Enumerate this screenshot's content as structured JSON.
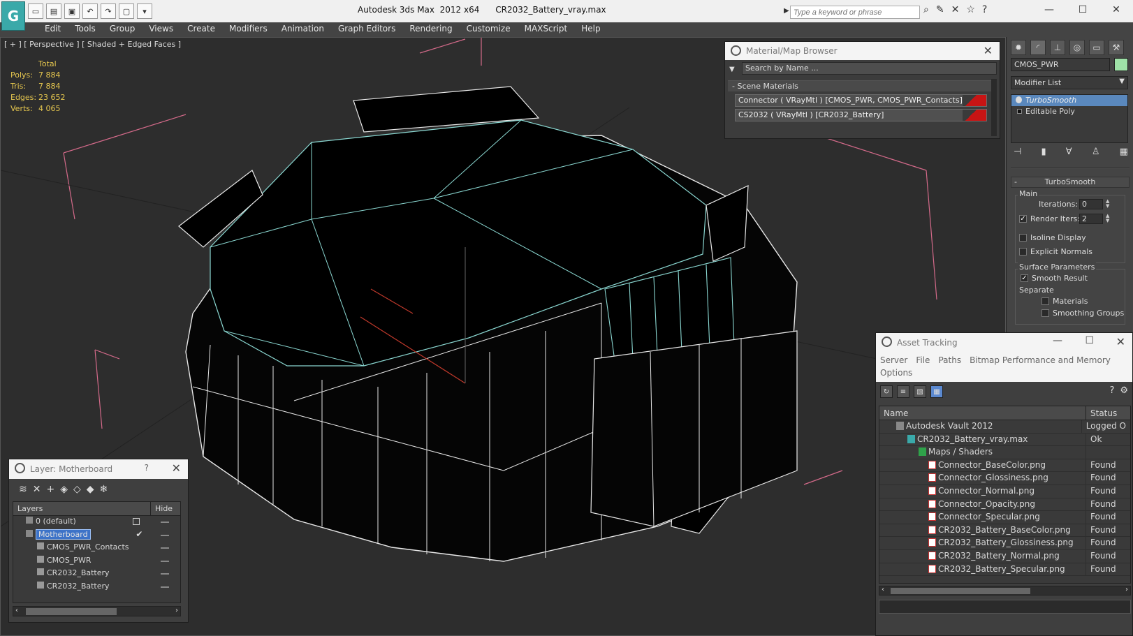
{
  "title": {
    "app": "Autodesk 3ds Max  2012 x64",
    "file": "CR2032_Battery_vray.max",
    "search_placeholder": "Type a keyword or phrase"
  },
  "menu": [
    "Edit",
    "Tools",
    "Group",
    "Views",
    "Create",
    "Modifiers",
    "Animation",
    "Graph Editors",
    "Rendering",
    "Customize",
    "MAXScript",
    "Help"
  ],
  "viewport": {
    "label": "[ + ] [ Perspective ] [ Shaded + Edged Faces ]",
    "stats": {
      "header": "Total",
      "rows": [
        {
          "k": "Polys:",
          "v": "7 884"
        },
        {
          "k": "Tris:",
          "v": "7 884"
        },
        {
          "k": "Edges:",
          "v": "23 652"
        },
        {
          "k": "Verts:",
          "v": "4 065"
        }
      ]
    }
  },
  "material_browser": {
    "title": "Material/Map Browser",
    "search": "Search by Name ...",
    "group": "- Scene Materials",
    "materials": [
      "Connector  ( VRayMtl ) [CMOS_PWR, CMOS_PWR_Contacts]",
      "CS2032  ( VRayMtl ) [CR2032_Battery]"
    ],
    "swatch_color": "#c81414"
  },
  "command_panel": {
    "object_name": "CMOS_PWR",
    "object_color": "#9fe2a8",
    "modifier_list": "Modifier List",
    "stack": [
      "TurboSmooth",
      "Editable Poly"
    ],
    "rollout": "TurboSmooth",
    "main_label": "Main",
    "iterations_label": "Iterations:",
    "iterations_value": "0",
    "render_iters_label": "Render Iters:",
    "render_iters_value": "2",
    "isoline": "Isoline Display",
    "explicit": "Explicit Normals",
    "surface_label": "Surface Parameters",
    "smooth_result": "Smooth Result",
    "separate": "Separate",
    "materials": "Materials",
    "smoothing_groups": "Smoothing Groups"
  },
  "asset_tracking": {
    "title": "Asset Tracking",
    "menu": [
      "Server",
      "File",
      "Paths",
      "Bitmap Performance and Memory",
      "Options"
    ],
    "columns": [
      "Name",
      "Status"
    ],
    "rows": [
      {
        "name": "Autodesk Vault 2012",
        "status": "Logged O",
        "indent": 1,
        "icon": "vault-icon"
      },
      {
        "name": "CR2032_Battery_vray.max",
        "status": "Ok",
        "indent": 2,
        "icon": "max-file-icon"
      },
      {
        "name": "Maps / Shaders",
        "status": "",
        "indent": 3,
        "icon": "maps-folder-icon"
      },
      {
        "name": "Connector_BaseColor.png",
        "status": "Found",
        "indent": 4,
        "icon": "png-icon"
      },
      {
        "name": "Connector_Glossiness.png",
        "status": "Found",
        "indent": 4,
        "icon": "png-icon"
      },
      {
        "name": "Connector_Normal.png",
        "status": "Found",
        "indent": 4,
        "icon": "png-icon"
      },
      {
        "name": "Connector_Opacity.png",
        "status": "Found",
        "indent": 4,
        "icon": "png-icon"
      },
      {
        "name": "Connector_Specular.png",
        "status": "Found",
        "indent": 4,
        "icon": "png-icon"
      },
      {
        "name": "CR2032_Battery_BaseColor.png",
        "status": "Found",
        "indent": 4,
        "icon": "png-icon"
      },
      {
        "name": "CR2032_Battery_Glossiness.png",
        "status": "Found",
        "indent": 4,
        "icon": "png-icon"
      },
      {
        "name": "CR2032_Battery_Normal.png",
        "status": "Found",
        "indent": 4,
        "icon": "png-icon"
      },
      {
        "name": "CR2032_Battery_Specular.png",
        "status": "Found",
        "indent": 4,
        "icon": "png-icon"
      }
    ]
  },
  "layer_manager": {
    "title": "Layer: Motherboard",
    "help": "?",
    "columns": [
      "Layers",
      "Hide"
    ],
    "rows": [
      {
        "name": "0 (default)",
        "indent": 1
      },
      {
        "name": "Motherboard",
        "indent": 1,
        "selected": true
      },
      {
        "name": "CMOS_PWR_Contacts",
        "indent": 2
      },
      {
        "name": "CMOS_PWR",
        "indent": 2
      },
      {
        "name": "CR2032_Battery",
        "indent": 2
      },
      {
        "name": "CR2032_Battery",
        "indent": 2
      }
    ]
  }
}
